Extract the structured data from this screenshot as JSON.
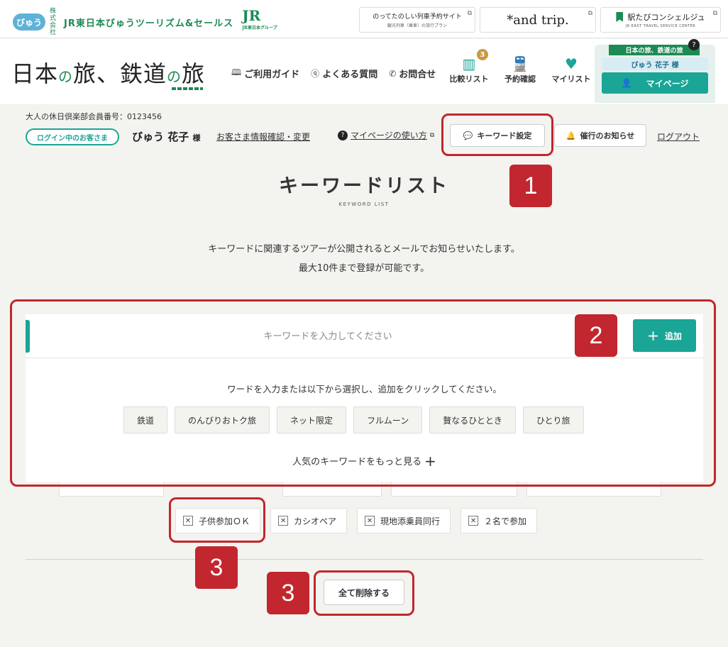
{
  "topbar": {
    "view_logo": "びゅう",
    "kaisha": "株式会社",
    "company_name": "JR東日本びゅうツーリズム&セールス",
    "jr_logo": "JR",
    "jr_sub": "JR東日本グループ",
    "link_noru": {
      "main": "のってたのしい列車予約サイト",
      "sub": "観光列車（乗車）の旅行プラン"
    },
    "link_andtrip": "*and trip.",
    "link_concierge": {
      "main": "駅たびコンシェルジュ",
      "sub": "JR EAST TRAVEL SERVICE CENTER"
    }
  },
  "header": {
    "logo_a": "日本",
    "logo_b": "の",
    "logo_c": "旅、鉄道",
    "logo_d": "の",
    "logo_e": "旅",
    "nav": [
      {
        "icon": "book-icon",
        "label": "ご利用ガイド"
      },
      {
        "icon": "question-icon",
        "label": "よくある質問"
      },
      {
        "icon": "phone-icon",
        "label": "お問合せ"
      }
    ],
    "icons": [
      {
        "name": "compare-list-icon",
        "label": "比較リスト",
        "badge": "3"
      },
      {
        "name": "train-icon",
        "label": "予約確認"
      },
      {
        "name": "heart-icon",
        "label": "マイリスト"
      }
    ],
    "mypage": {
      "ribbon": "日本の旅、鉄道の旅",
      "help": "?",
      "name": "びゅう 花子 様",
      "button": "マイページ"
    }
  },
  "member": {
    "number": "大人の休日倶楽部会員番号：0123456",
    "login_badge": "ログイン中のお客さま",
    "name": "びゅう 花子",
    "sama": "様",
    "info_link": "お客さま情報確認・変更",
    "guide_link": "マイページの使い方",
    "keyword_button": "キーワード設定",
    "notice_button": "催行のお知らせ",
    "logout": "ログアウト"
  },
  "annotations": [
    "1",
    "2",
    "3",
    "3"
  ],
  "page": {
    "title": "キーワードリスト",
    "subtitle": "KEYWORD LIST",
    "desc_line1": "キーワードに関連するツアーが公開されるとメールでお知らせいたします。",
    "desc_line2": "最大10件まで登録が可能です。"
  },
  "keyword_box": {
    "placeholder": "キーワードを入力してください",
    "add_button": "追加",
    "help": "ワードを入力または以下から選択し、追加をクリックしてください。",
    "suggestions": [
      "鉄道",
      "のんびりおトク旅",
      "ネット限定",
      "フルムーン",
      "贅なるひととき",
      "ひとり旅"
    ],
    "more": "人気のキーワードをもっと見る"
  },
  "registered": [
    "子供参加ＯＫ",
    "カシオペア",
    "現地添乗員同行",
    "２名で参加"
  ],
  "delete_all": "全て削除する",
  "colors": {
    "accent": "#1aa596",
    "brand_green": "#1d8a55",
    "annotation_red": "#c2262e",
    "badge_gold": "#c99a3f"
  }
}
